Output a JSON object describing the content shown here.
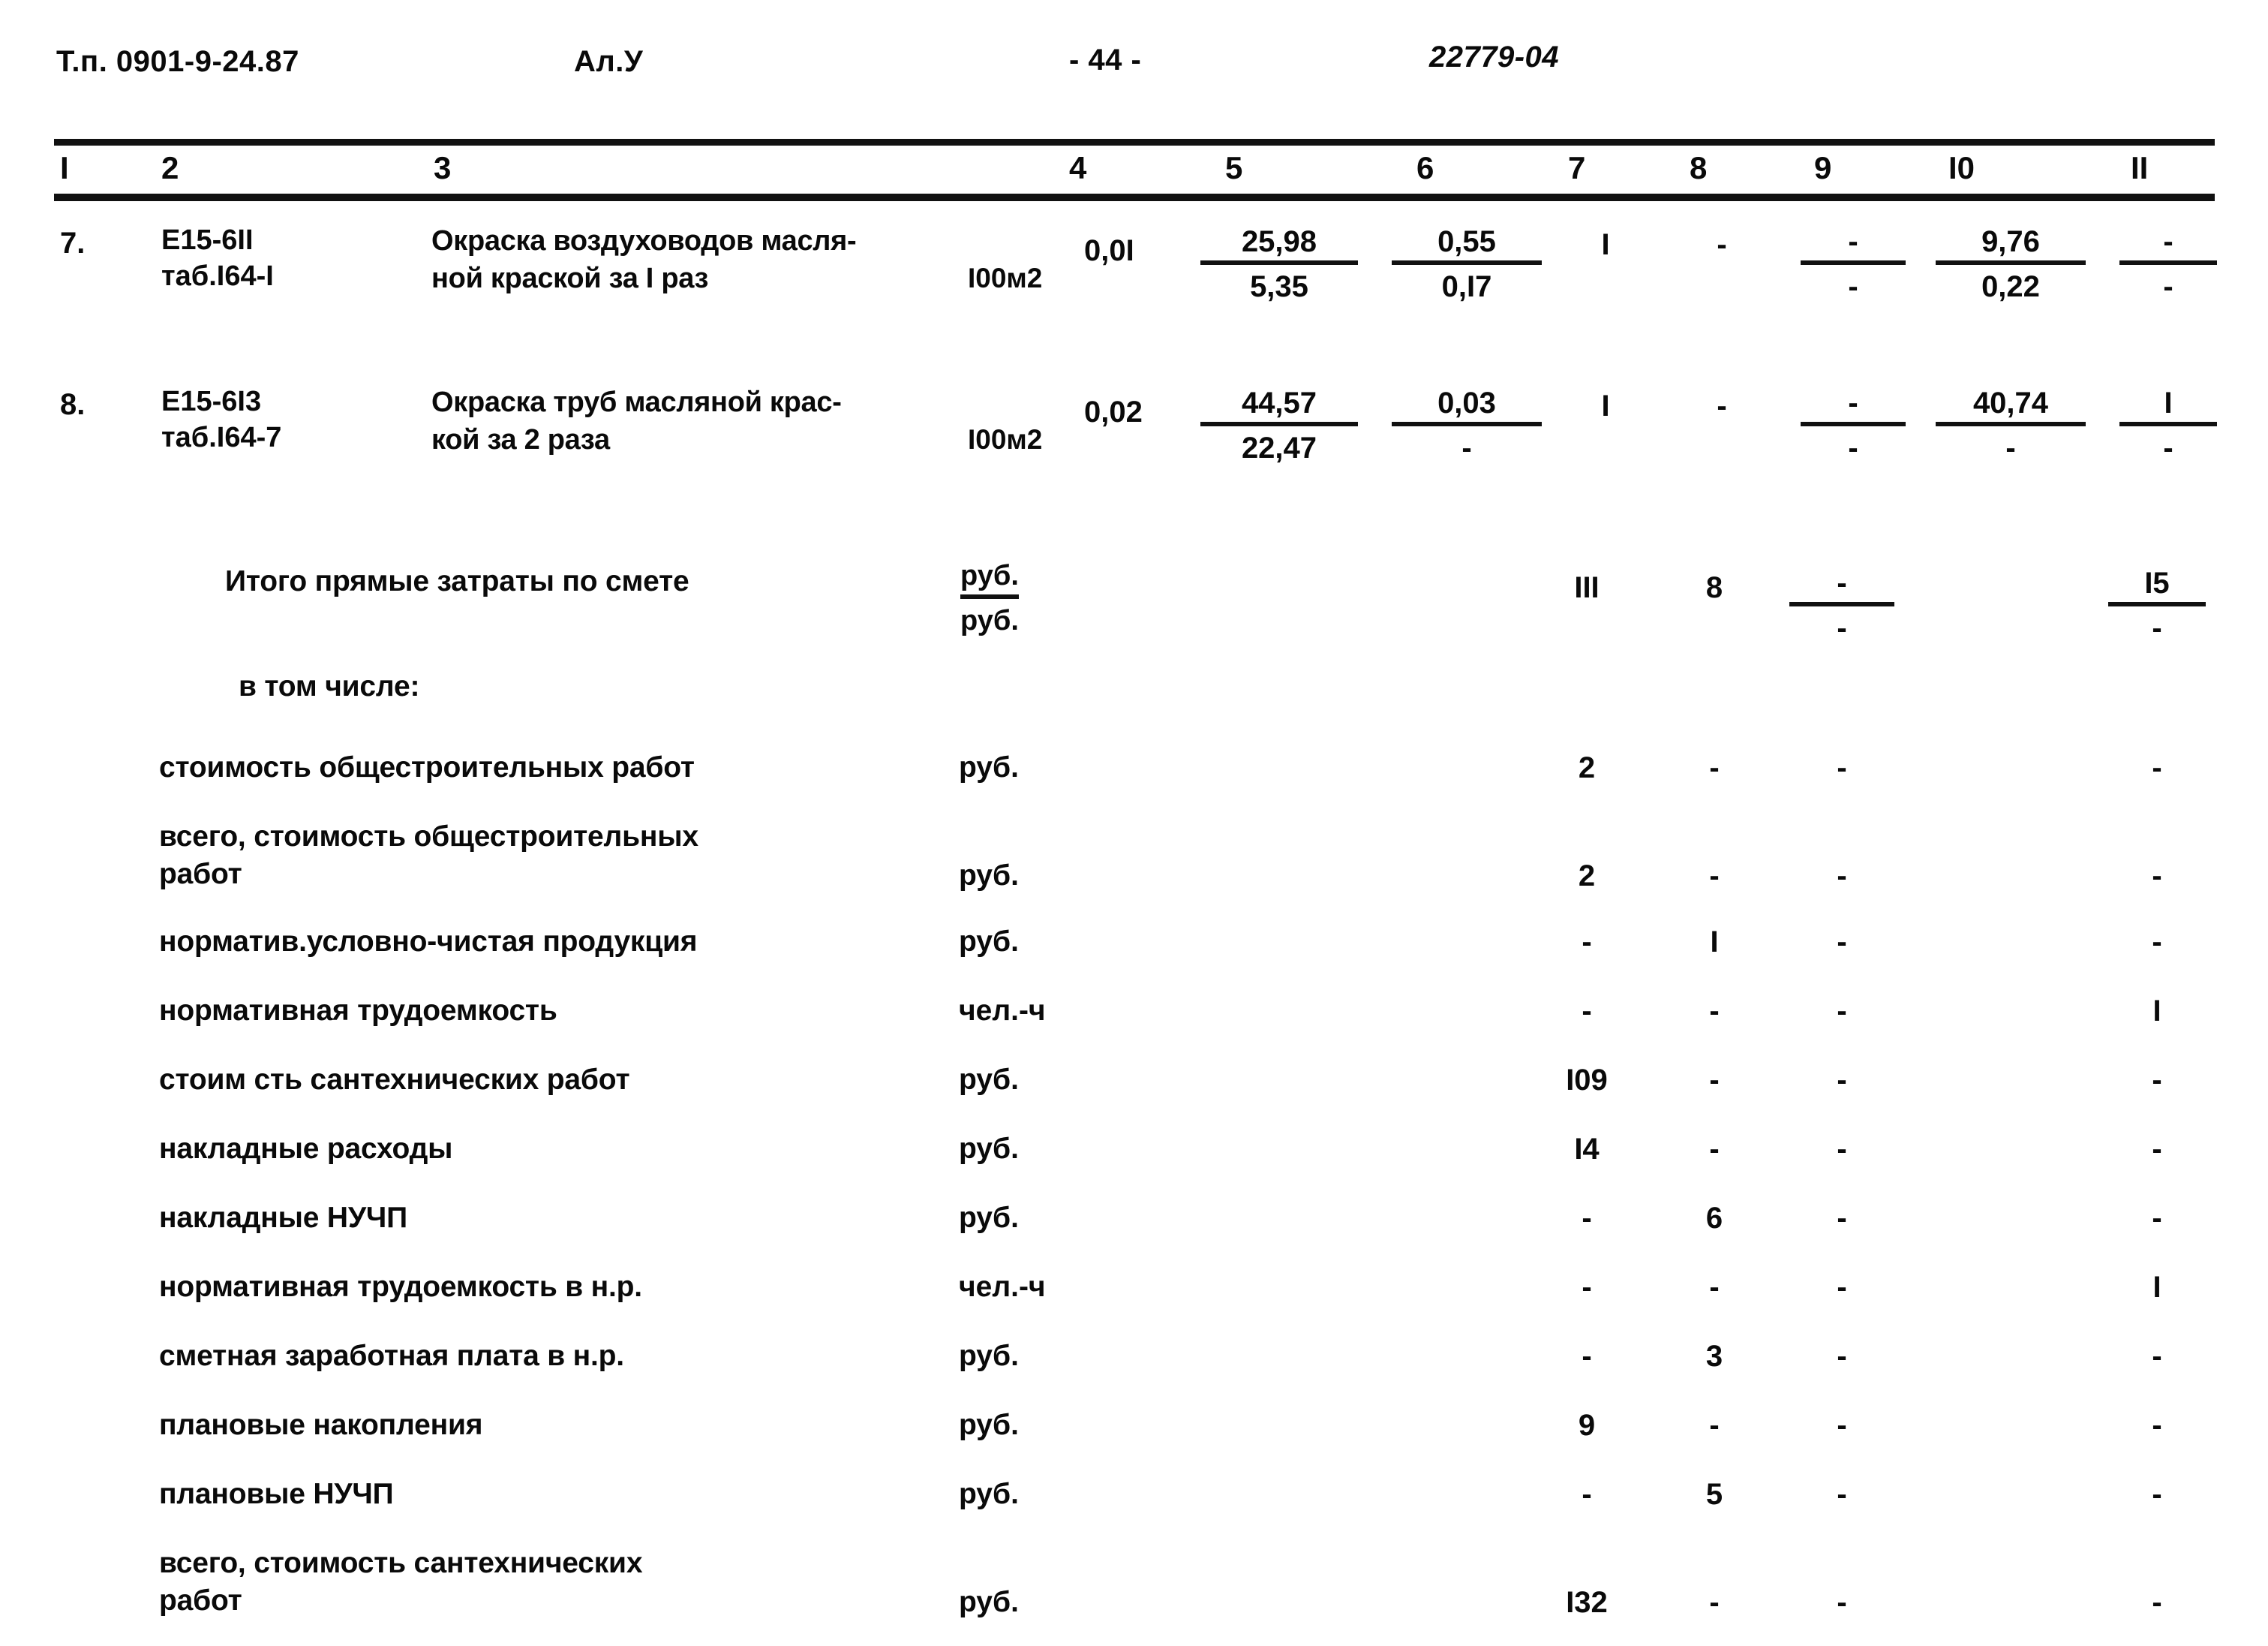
{
  "header": {
    "doc_type": "Т.п. 0901-9-24.87",
    "album": "Ал.У",
    "page": "- 44 -",
    "code": "22779-04"
  },
  "column_numbers": [
    "I",
    "2",
    "3",
    "4",
    "5",
    "6",
    "7",
    "8",
    "9",
    "I0",
    "II"
  ],
  "items": [
    {
      "num": "7.",
      "code_line1": "Е15-6II",
      "code_line2": "таб.I64-I",
      "desc_line1": "Окраска воздуховодов масля-",
      "desc_line2": "ной краской за I раз",
      "unit": "I00м2",
      "qty": "0,0I",
      "c5_num": "25,98",
      "c5_den": "5,35",
      "c6_num": "0,55",
      "c6_den": "0,I7",
      "c7": "I",
      "c8": "-",
      "c9_num": "-",
      "c9_den": "-",
      "c10_num": "9,76",
      "c10_den": "0,22",
      "c11_num": "-",
      "c11_den": "-"
    },
    {
      "num": "8.",
      "code_line1": "Е15-6I3",
      "code_line2": "таб.I64-7",
      "desc_line1": "Окраска труб масляной крас-",
      "desc_line2": "кой за 2 раза",
      "unit": "I00м2",
      "qty": "0,02",
      "c5_num": "44,57",
      "c5_den": "22,47",
      "c6_num": "0,03",
      "c6_den": "-",
      "c7": "I",
      "c8": "-",
      "c9_num": "-",
      "c9_den": "-",
      "c10_num": "40,74",
      "c10_den": "-",
      "c11_num": "I",
      "c11_den": "-"
    }
  ],
  "totals": {
    "label": "Итого прямые затраты по смете",
    "unit_num": "руб.",
    "unit_den": "руб.",
    "c7": "III",
    "c8": "8",
    "c9_num": "-",
    "c9_den": "-",
    "c10": "",
    "c11_num": "I5",
    "c11_den": "-"
  },
  "including_label": "в том числе:",
  "breakdown": [
    {
      "label": "стоимость общестроительных работ",
      "label2": "",
      "unit": "руб.",
      "c7": "2",
      "c8": "-",
      "c9": "-",
      "c10": "",
      "c11": "-"
    },
    {
      "label": "всего, стоимость общестроительных",
      "label2": "работ",
      "unit": "руб.",
      "c7": "2",
      "c8": "-",
      "c9": "-",
      "c10": "",
      "c11": "-"
    },
    {
      "label": "норматив.условно-чистая продукция",
      "label2": "",
      "unit": "руб.",
      "c7": "-",
      "c8": "I",
      "c9": "-",
      "c10": "",
      "c11": "-"
    },
    {
      "label": "нормативная трудоемкость",
      "label2": "",
      "unit": "чел.-ч",
      "c7": "-",
      "c8": "-",
      "c9": "-",
      "c10": "",
      "c11": "I"
    },
    {
      "label": "стоим сть сантехнических работ",
      "label2": "",
      "unit": "руб.",
      "c7": "I09",
      "c8": "-",
      "c9": "-",
      "c10": "",
      "c11": "-"
    },
    {
      "label": "накладные расходы",
      "label2": "",
      "unit": "руб.",
      "c7": "I4",
      "c8": "-",
      "c9": "-",
      "c10": "",
      "c11": "-"
    },
    {
      "label": "накладные НУЧП",
      "label2": "",
      "unit": "руб.",
      "c7": "-",
      "c8": "6",
      "c9": "-",
      "c10": "",
      "c11": "-"
    },
    {
      "label": "нормативная трудоемкость в н.р.",
      "label2": "",
      "unit": "чел.-ч",
      "c7": "-",
      "c8": "-",
      "c9": "-",
      "c10": "",
      "c11": "I"
    },
    {
      "label": "сметная заработная плата в н.р.",
      "label2": "",
      "unit": "руб.",
      "c7": "-",
      "c8": "3",
      "c9": "-",
      "c10": "",
      "c11": "-"
    },
    {
      "label": "плановые накопления",
      "label2": "",
      "unit": "руб.",
      "c7": "9",
      "c8": "-",
      "c9": "-",
      "c10": "",
      "c11": "-"
    },
    {
      "label": "плановые НУЧП",
      "label2": "",
      "unit": "руб.",
      "c7": "-",
      "c8": "5",
      "c9": "-",
      "c10": "",
      "c11": "-"
    },
    {
      "label": "всего, стоимость сантехнических",
      "label2": "работ",
      "unit": "руб.",
      "c7": "I32",
      "c8": "-",
      "c9": "-",
      "c10": "",
      "c11": "-"
    }
  ]
}
